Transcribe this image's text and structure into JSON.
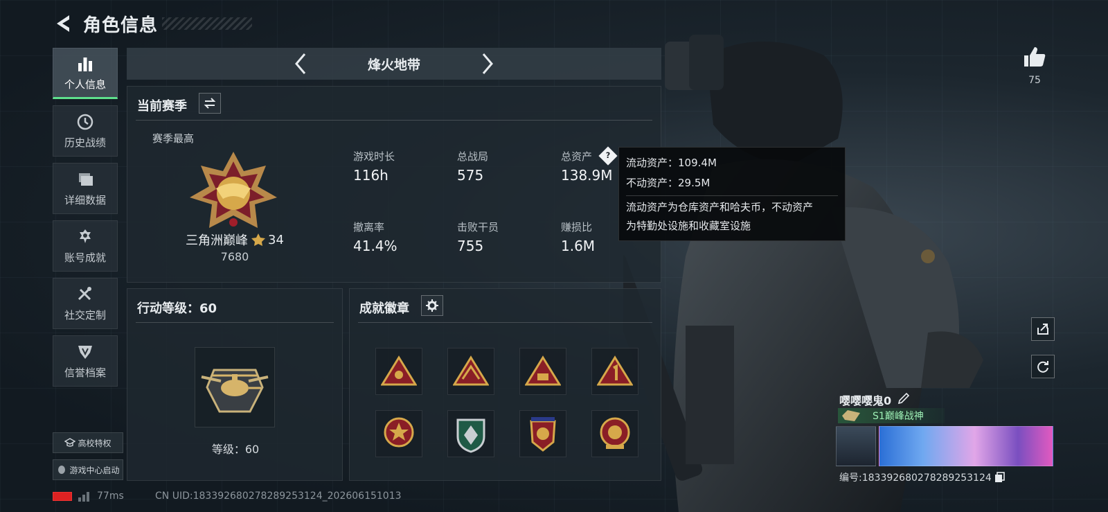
{
  "header": {
    "title": "角色信息"
  },
  "sidebar": {
    "items": [
      {
        "label": "个人信息",
        "icon": "bar-chart-icon",
        "active": true
      },
      {
        "label": "历史战绩",
        "icon": "clock-icon"
      },
      {
        "label": "详细数据",
        "icon": "folder-icon"
      },
      {
        "label": "账号成就",
        "icon": "achievement-icon"
      },
      {
        "label": "社交定制",
        "icon": "tools-icon"
      },
      {
        "label": "信誉档案",
        "icon": "shield-icon"
      }
    ],
    "campus_label": "高校特权",
    "game_center_label": "游戏中心启动"
  },
  "mode": {
    "name": "烽火地带"
  },
  "season": {
    "title": "当前赛季",
    "best_label": "赛季最高",
    "rank_name": "三角洲巅峰",
    "rank_stars": "34",
    "rank_score": "7680",
    "stats": [
      {
        "label": "游戏时长",
        "value": "116h"
      },
      {
        "label": "总战局",
        "value": "575"
      },
      {
        "label": "总资产",
        "value": "138.9M"
      },
      {
        "label": "撤离率",
        "value": "41.4%"
      },
      {
        "label": "击败干员",
        "value": "755"
      },
      {
        "label": "赚损比",
        "value": "1.6M"
      }
    ]
  },
  "tooltip": {
    "liquid": "流动资产：109.4M",
    "fixed": "不动资产：29.5M",
    "desc_line1": "流动资产为仓库资产和哈夫币，不动资产",
    "desc_line2": "为特勤处设施和收藏室设施"
  },
  "action_level": {
    "title": "行动等级：60",
    "level_label": "等级：60"
  },
  "achievements": {
    "title": "成就徽章"
  },
  "right": {
    "like_count": "75",
    "player_name": "嘤嘤嘤鬼0",
    "player_title": "S1巅峰战神",
    "player_id": "编号:1833926802782892531​24"
  },
  "footer": {
    "ping": "77ms",
    "uid": "CN UID:18339268027828925312​4_202606151013"
  },
  "colors": {
    "accent": "#5ee08c",
    "gold": "#d6a84a"
  }
}
